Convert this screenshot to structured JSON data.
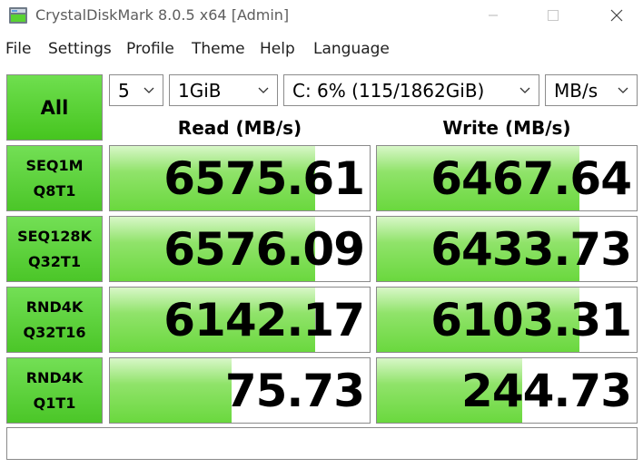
{
  "window": {
    "title": "CrystalDiskMark 8.0.5 x64 [Admin]"
  },
  "menu": {
    "items": [
      "File",
      "Settings",
      "Profile",
      "Theme",
      "Help",
      "Language"
    ]
  },
  "controls": {
    "all_label": "All",
    "count": "5",
    "size": "1GiB",
    "drive": "C: 6% (115/1862GiB)",
    "unit": "MB/s"
  },
  "headers": {
    "read": "Read (MB/s)",
    "write": "Write (MB/s)"
  },
  "rows": [
    {
      "label1": "SEQ1M",
      "label2": "Q8T1",
      "read": "6575.61",
      "write": "6467.64",
      "read_fill": 0.79,
      "write_fill": 0.78
    },
    {
      "label1": "SEQ128K",
      "label2": "Q32T1",
      "read": "6576.09",
      "write": "6433.73",
      "read_fill": 0.79,
      "write_fill": 0.78
    },
    {
      "label1": "RND4K",
      "label2": "Q32T16",
      "read": "6142.17",
      "write": "6103.31",
      "read_fill": 0.79,
      "write_fill": 0.78
    },
    {
      "label1": "RND4K",
      "label2": "Q1T1",
      "read": "75.73",
      "write": "244.73",
      "read_fill": 0.47,
      "write_fill": 0.56
    }
  ],
  "status": ""
}
